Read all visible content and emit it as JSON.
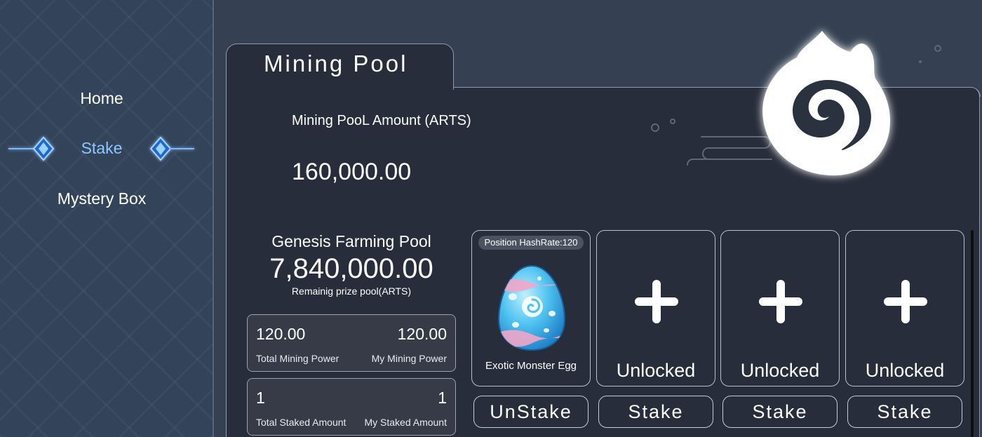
{
  "sidebar": {
    "items": [
      {
        "label": "Home",
        "active": false
      },
      {
        "label": "Stake",
        "active": true
      },
      {
        "label": "Mystery Box",
        "active": false
      }
    ],
    "active_color": "#8ec6ff"
  },
  "panel": {
    "tab_title": "Mining Pool",
    "pool_amount_label": "Mining PooL Amount (ARTS)",
    "pool_amount_value": "160,000.00"
  },
  "genesis": {
    "title": "Genesis Farming Pool",
    "amount": "7,840,000.00",
    "subtitle": "Remainig prize pool(ARTS)"
  },
  "stats": {
    "total_mining_power": "120.00",
    "total_mining_power_label": "Total Mining Power",
    "my_mining_power": "120.00",
    "my_mining_power_label": "My Mining Power",
    "total_staked": "1",
    "total_staked_label": "Total Staked Amount",
    "my_staked": "1",
    "my_staked_label": "My Staked Amount"
  },
  "slots": [
    {
      "hashrate": "Position HashRate:120",
      "name": "Exotic Monster Egg",
      "icon": "egg-icon",
      "action": "UnStake"
    },
    {
      "label": "Unlocked",
      "icon": "plus-icon",
      "action": "Stake"
    },
    {
      "label": "Unlocked",
      "icon": "plus-icon",
      "action": "Stake"
    },
    {
      "label": "Unlocked",
      "icon": "plus-icon",
      "action": "Stake"
    }
  ],
  "icons": {
    "logo": "swirl-flame-logo",
    "nav_decoration": "diamond-ornament-icon"
  }
}
